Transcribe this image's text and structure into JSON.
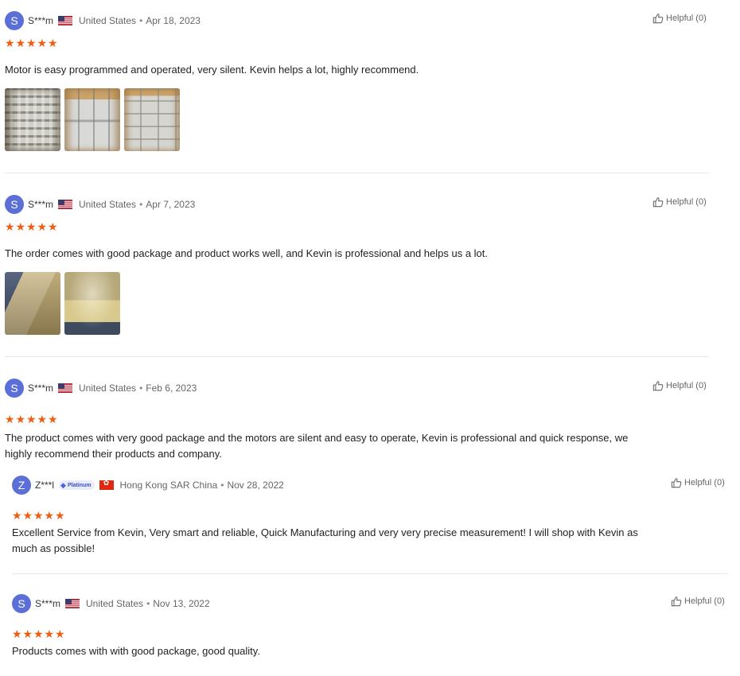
{
  "reviews": [
    {
      "avatar_letter": "S",
      "username": "S***m",
      "flag": "us-flag-icon",
      "country": "United States",
      "date": "Apr 18, 2023",
      "rating": 5,
      "helpful": "Helpful (0)",
      "text": "Motor is easy programmed and operated, very silent. Kevin helps a lot, highly recommend.",
      "photo_count": 3
    },
    {
      "avatar_letter": "S",
      "username": "S***m",
      "flag": "us-flag-icon",
      "country": "United States",
      "date": "Apr 7, 2023",
      "rating": 5,
      "helpful": "Helpful (0)",
      "text": "The order comes with good package and product works well, and Kevin is professional and helps us a lot.",
      "photo_count": 2
    },
    {
      "avatar_letter": "S",
      "username": "S***m",
      "flag": "us-flag-icon",
      "country": "United States",
      "date": "Feb 6, 2023",
      "rating": 5,
      "helpful": "Helpful (0)",
      "text_line1": "The product comes with very good package and the motors are silent and easy to operate, Kevin is professional and quick response, we",
      "text_line2": "highly recommend their products and company."
    },
    {
      "avatar_letter": "Z",
      "username": "Z***l",
      "badge": "Platinum",
      "flag": "hong-kong-flag-icon",
      "country": "Hong Kong SAR China",
      "date": "Nov 28, 2022",
      "rating": 5,
      "helpful": "Helpful (0)",
      "text_line1": "Excellent Service from Kevin, Very smart and reliable, Quick Manufacturing and very very precise measurement! I will shop with Kevin as",
      "text_line2": "much as possible!"
    },
    {
      "avatar_letter": "S",
      "username": "S***m",
      "flag": "us-flag-icon",
      "country": "United States",
      "date": "Nov 13, 2022",
      "rating": 5,
      "helpful": "Helpful (0)",
      "text": "Products comes with with good package, good quality."
    }
  ],
  "colors": {
    "avatar": "#5b6fd6",
    "star": "#f05c12",
    "divider": "#e6e6e6",
    "muted_text": "#666666"
  },
  "separator": "•",
  "star_glyph": "★"
}
